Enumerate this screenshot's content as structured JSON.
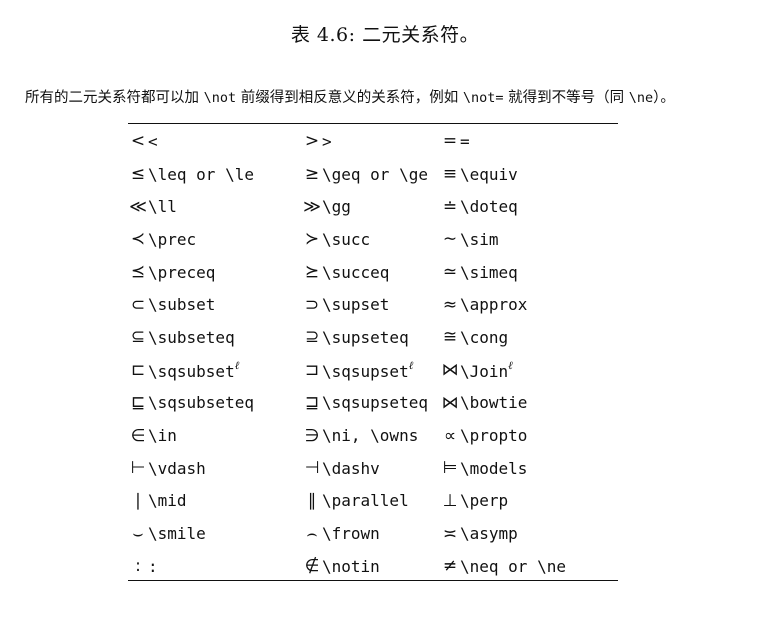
{
  "caption": "表 4.6: 二元关系符。",
  "intro": {
    "part1": "所有的二元关系符都可以加 ",
    "code1": "\\not",
    "part2": " 前缀得到相反意义的关系符，例如 ",
    "code2": "\\not=",
    "part3": " 就得到不等号（同 ",
    "code3": "\\ne",
    "part4": "）。"
  },
  "table": {
    "rows": [
      {
        "cells": [
          {
            "sym": "<",
            "cmd": "<"
          },
          {
            "sym": ">",
            "cmd": ">"
          },
          {
            "sym": "=",
            "cmd": "="
          }
        ]
      },
      {
        "cells": [
          {
            "sym": "≤",
            "cmd": "\\leq or \\le"
          },
          {
            "sym": "≥",
            "cmd": "\\geq or \\ge"
          },
          {
            "sym": "≡",
            "cmd": "\\equiv"
          }
        ]
      },
      {
        "cells": [
          {
            "sym": "≪",
            "cmd": "\\ll"
          },
          {
            "sym": "≫",
            "cmd": "\\gg"
          },
          {
            "sym": "≐",
            "cmd": "\\doteq"
          }
        ]
      },
      {
        "cells": [
          {
            "sym": "≺",
            "cmd": "\\prec"
          },
          {
            "sym": "≻",
            "cmd": "\\succ"
          },
          {
            "sym": "∼",
            "cmd": "\\sim"
          }
        ]
      },
      {
        "cells": [
          {
            "sym": "⪯",
            "cmd": "\\preceq"
          },
          {
            "sym": "⪰",
            "cmd": "\\succeq"
          },
          {
            "sym": "≃",
            "cmd": "\\simeq"
          }
        ]
      },
      {
        "cells": [
          {
            "sym": "⊂",
            "cmd": "\\subset"
          },
          {
            "sym": "⊃",
            "cmd": "\\supset"
          },
          {
            "sym": "≈",
            "cmd": "\\approx"
          }
        ]
      },
      {
        "cells": [
          {
            "sym": "⊆",
            "cmd": "\\subseteq"
          },
          {
            "sym": "⊇",
            "cmd": "\\supseteq"
          },
          {
            "sym": "≅",
            "cmd": "\\cong"
          }
        ]
      },
      {
        "cells": [
          {
            "sym": "⊏",
            "cmd": "\\sqsubset",
            "sup": "ℓ"
          },
          {
            "sym": "⊐",
            "cmd": "\\sqsupset",
            "sup": "ℓ"
          },
          {
            "sym": "⋈",
            "cmd": "\\Join",
            "sup": "ℓ"
          }
        ]
      },
      {
        "cells": [
          {
            "sym": "⊑",
            "cmd": "\\sqsubseteq"
          },
          {
            "sym": "⊒",
            "cmd": "\\sqsupseteq"
          },
          {
            "sym": "⋈",
            "cmd": "\\bowtie"
          }
        ]
      },
      {
        "cells": [
          {
            "sym": "∈",
            "cmd": "\\in"
          },
          {
            "sym": "∋",
            "cmd": "\\ni, \\owns"
          },
          {
            "sym": "∝",
            "cmd": "\\propto"
          }
        ]
      },
      {
        "cells": [
          {
            "sym": "⊢",
            "cmd": "\\vdash"
          },
          {
            "sym": "⊣",
            "cmd": "\\dashv"
          },
          {
            "sym": "⊨",
            "cmd": "\\models"
          }
        ]
      },
      {
        "cells": [
          {
            "sym": "∣",
            "cmd": "\\mid"
          },
          {
            "sym": "∥",
            "cmd": "\\parallel"
          },
          {
            "sym": "⊥",
            "cmd": "\\perp"
          }
        ]
      },
      {
        "cells": [
          {
            "sym": "⌣",
            "cmd": "\\smile"
          },
          {
            "sym": "⌢",
            "cmd": "\\frown"
          },
          {
            "sym": "≍",
            "cmd": "\\asymp"
          }
        ]
      },
      {
        "cells": [
          {
            "sym": ":",
            "cmd": ":"
          },
          {
            "sym": "∉",
            "cmd": "\\notin"
          },
          {
            "sym": "≠",
            "cmd": "\\neq or \\ne"
          }
        ]
      }
    ]
  }
}
